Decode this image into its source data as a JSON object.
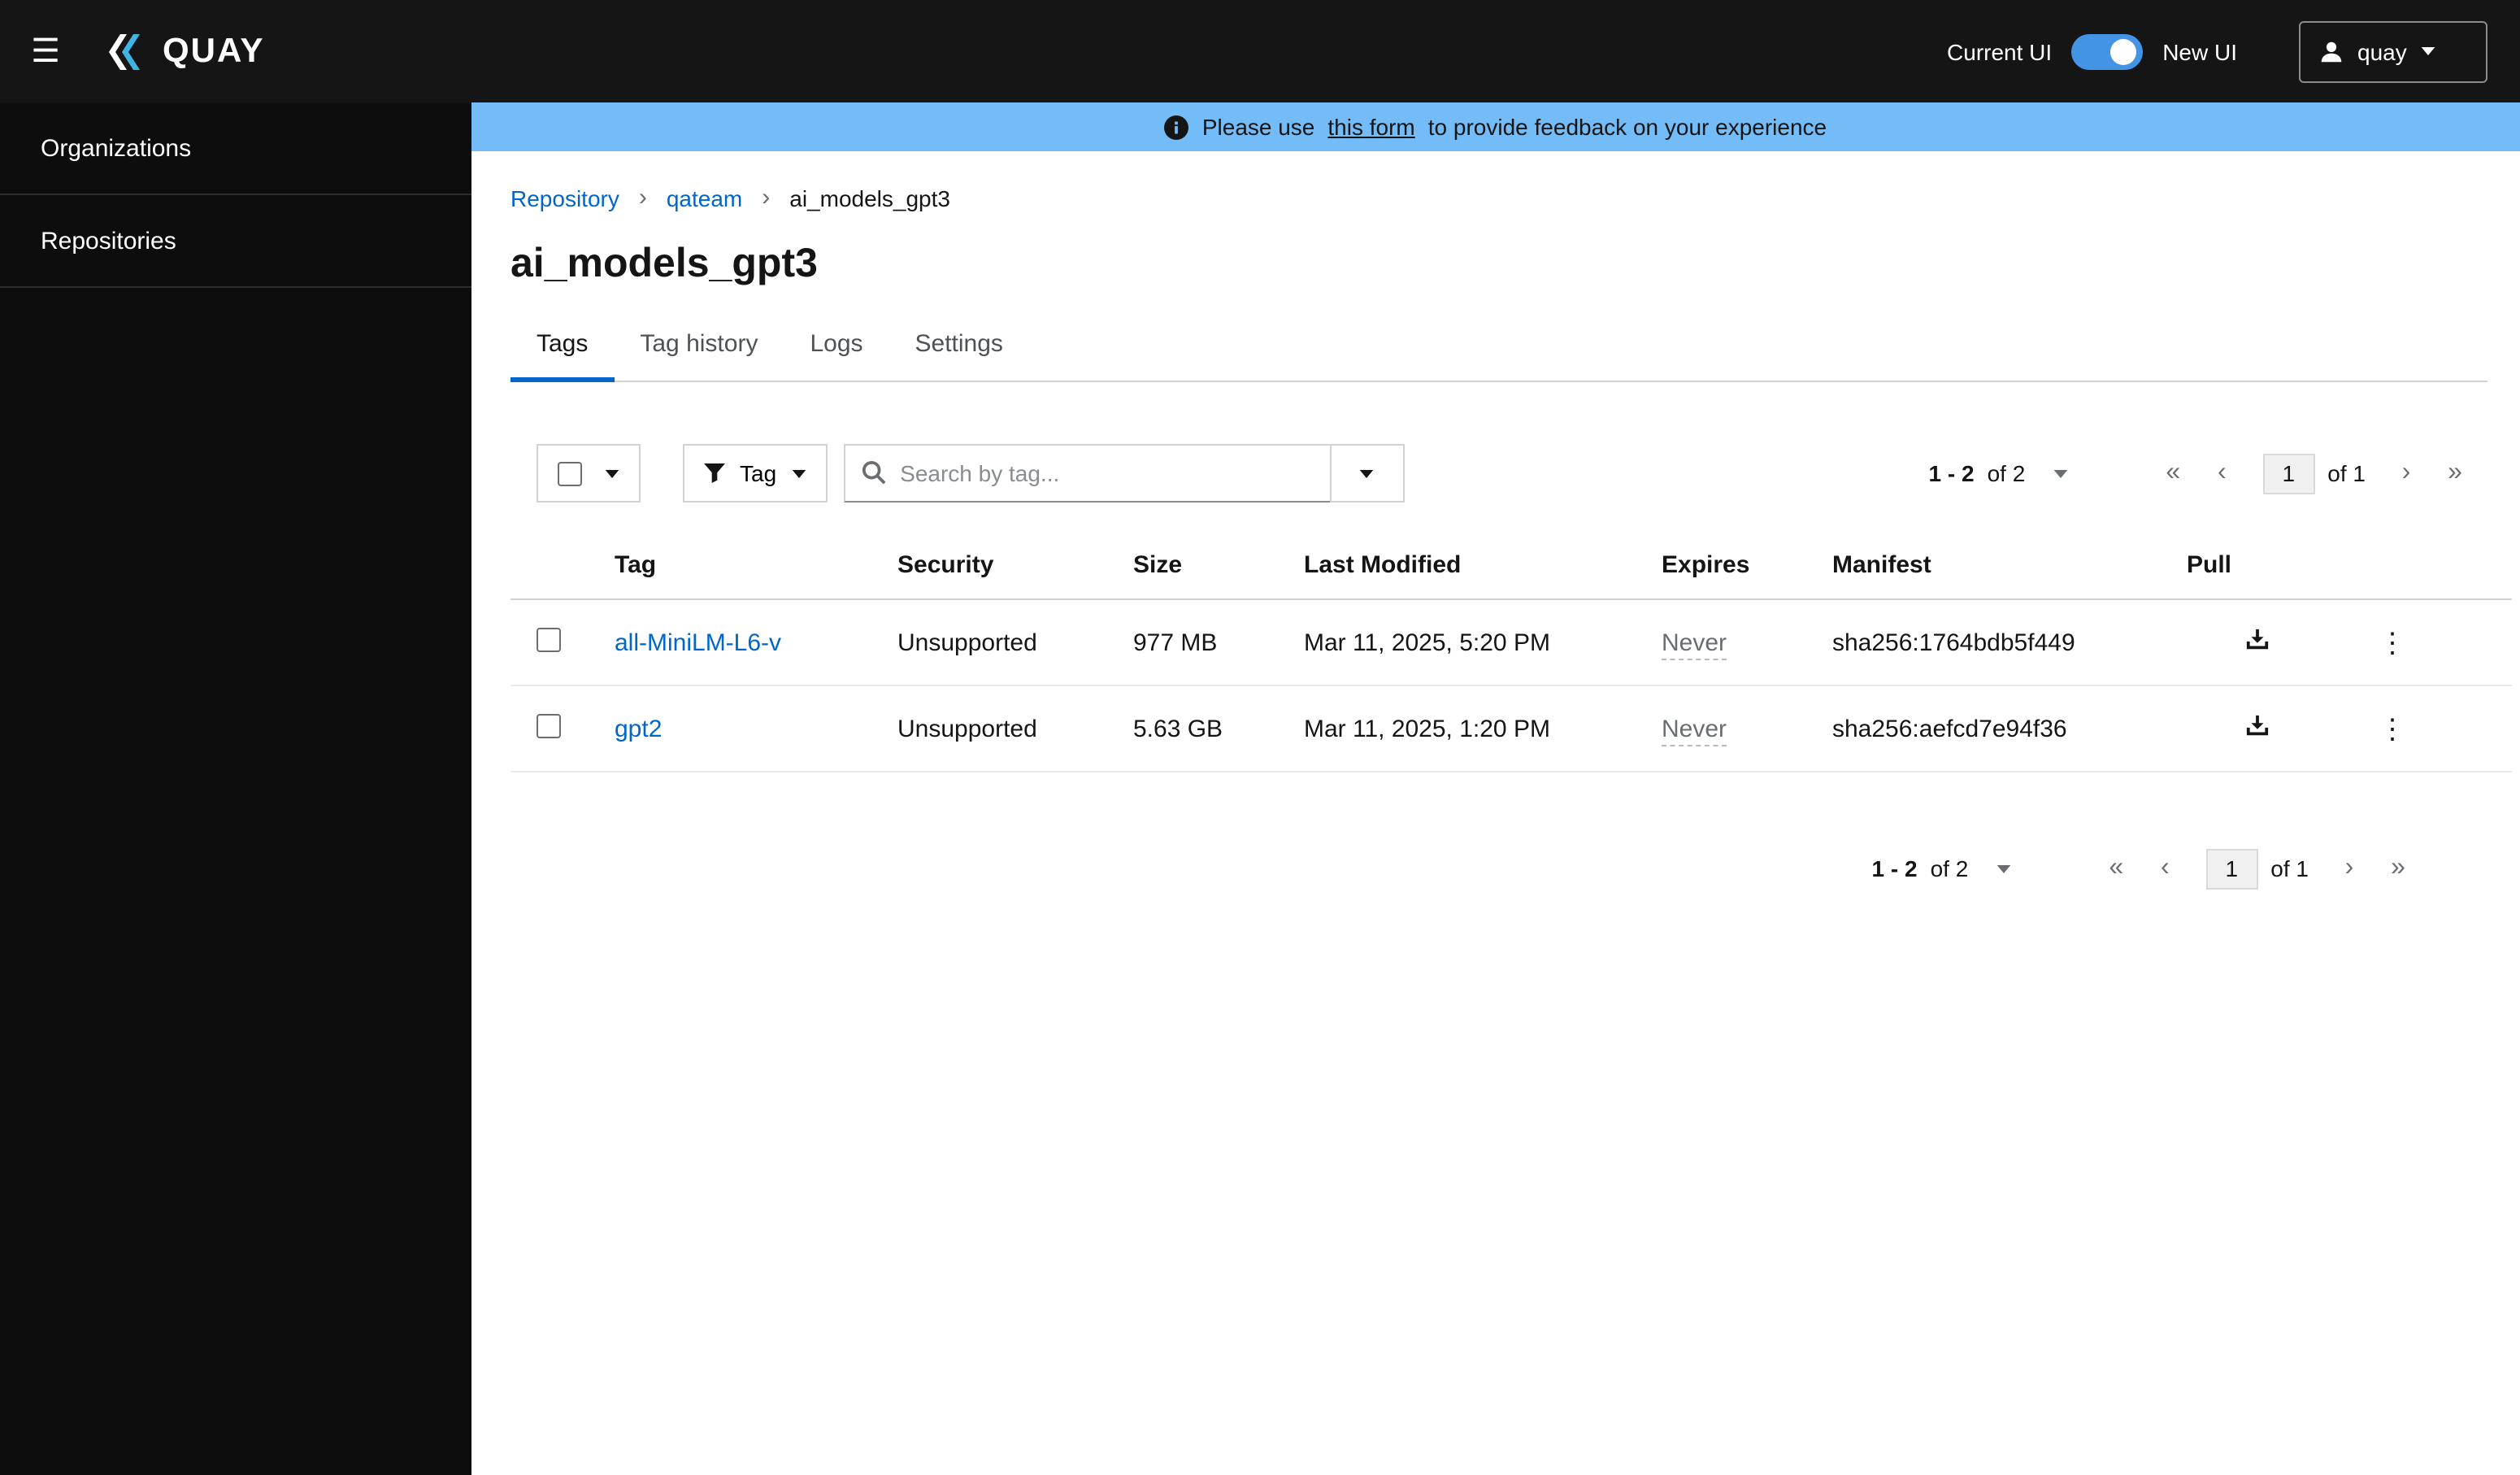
{
  "header": {
    "brand": "QUAY",
    "current_ui": "Current UI",
    "new_ui": "New UI",
    "user": "quay"
  },
  "icons": {
    "hamburger": "☰",
    "kebab": "⋮",
    "angle_double_left": "«",
    "angle_left": "‹",
    "angle_right": "›",
    "angle_double_right": "»",
    "breadcrumb_separator": "›"
  },
  "colors": {
    "header_bg": "#151515",
    "banner_bg": "#73bcf7",
    "link": "#0066cc",
    "active_tab_underline": "#0066cc",
    "toggle_on": "#4394e5",
    "logo_blue": "#40b4e5"
  },
  "sidebar": {
    "items": [
      {
        "label": "Organizations"
      },
      {
        "label": "Repositories"
      }
    ]
  },
  "banner": {
    "prefix": "Please use",
    "link": "this form",
    "suffix": "to provide feedback on your experience"
  },
  "breadcrumb": {
    "items": [
      {
        "label": "Repository"
      },
      {
        "label": "qateam"
      },
      {
        "label": "ai_models_gpt3"
      }
    ]
  },
  "page": {
    "title": "ai_models_gpt3"
  },
  "tabs": [
    {
      "label": "Tags"
    },
    {
      "label": "Tag history"
    },
    {
      "label": "Logs"
    },
    {
      "label": "Settings"
    }
  ],
  "toolbar": {
    "filter_label": "Tag",
    "search_placeholder": "Search by tag..."
  },
  "pagination_top": {
    "range_strong": "1 - 2",
    "range_rest": "of 2",
    "page": "1",
    "of_label": "of 1"
  },
  "pagination_bottom": {
    "range_strong": "1 - 2",
    "range_rest": "of 2",
    "page": "1",
    "of_label": "of 1"
  },
  "table": {
    "columns": [
      "Tag",
      "Security",
      "Size",
      "Last Modified",
      "Expires",
      "Manifest",
      "Pull"
    ],
    "rows": [
      {
        "tag": "all-MiniLM-L6-v",
        "security": "Unsupported",
        "size": "977 MB",
        "last_modified": "Mar 11, 2025, 5:20 PM",
        "expires": "Never",
        "manifest": "sha256:1764bdb5f449"
      },
      {
        "tag": "gpt2",
        "security": "Unsupported",
        "size": "5.63 GB",
        "last_modified": "Mar 11, 2025, 1:20 PM",
        "expires": "Never",
        "manifest": "sha256:aefcd7e94f36"
      }
    ]
  }
}
